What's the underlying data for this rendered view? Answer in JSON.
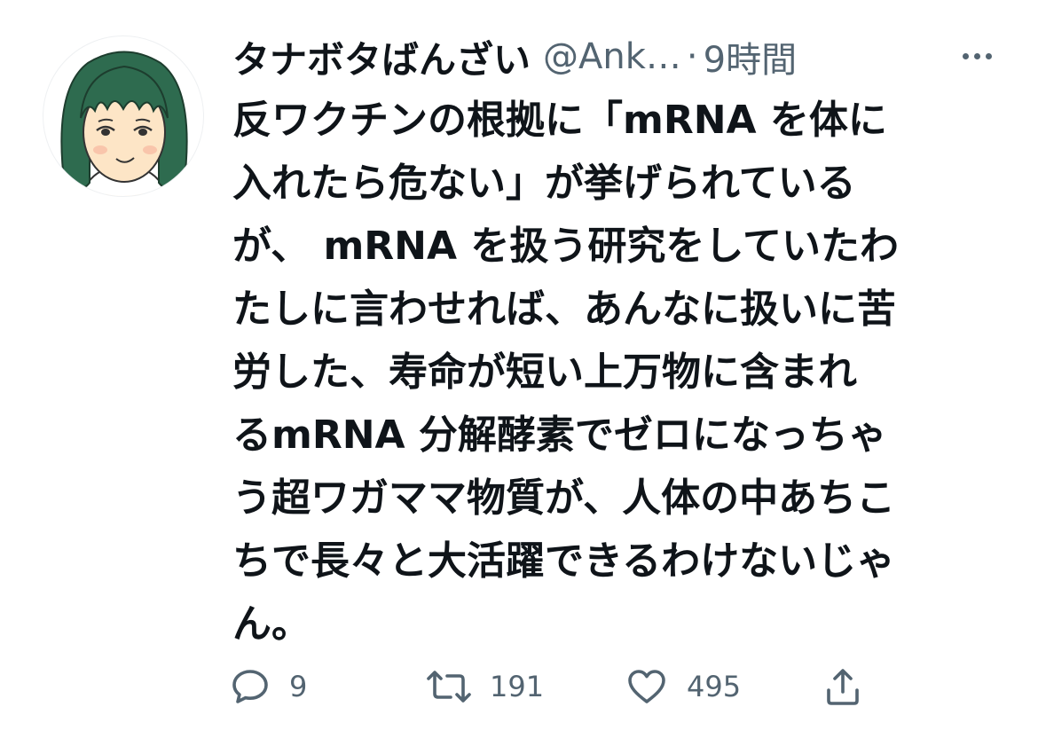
{
  "tweet": {
    "author": {
      "display_name": "タナボタばんざい",
      "handle": "@Ank…",
      "avatar_icon": "cartoon-woman-avatar"
    },
    "separator": "·",
    "time": "9時間",
    "more_icon": "more-horizontal-icon",
    "text_lines": [
      "反ワクチンの根拠に「mRNA を体に",
      "入れたら危ない」が挙げられている",
      "が、 mRNA を扱う研究をしていたわ",
      "たしに言わせれば、あんなに扱いに苦",
      "労した、寿命が短い上万物に含まれ",
      "るmRNA 分解酵素でゼロになっちゃ",
      "う超ワガママ物質が、人体の中あちこ",
      "ちで長々と大活躍できるわけないじゃ",
      "ん。"
    ],
    "actions": {
      "reply": {
        "icon": "reply-bubble-icon",
        "count": "9"
      },
      "retweet": {
        "icon": "retweet-icon",
        "count": "191"
      },
      "like": {
        "icon": "heart-icon",
        "count": "495"
      },
      "share": {
        "icon": "share-upload-icon"
      }
    }
  },
  "colors": {
    "text": "#0f1419",
    "muted": "#536471",
    "avatar_hair": "#2e6b4f",
    "avatar_skin": "#fde5c6"
  }
}
